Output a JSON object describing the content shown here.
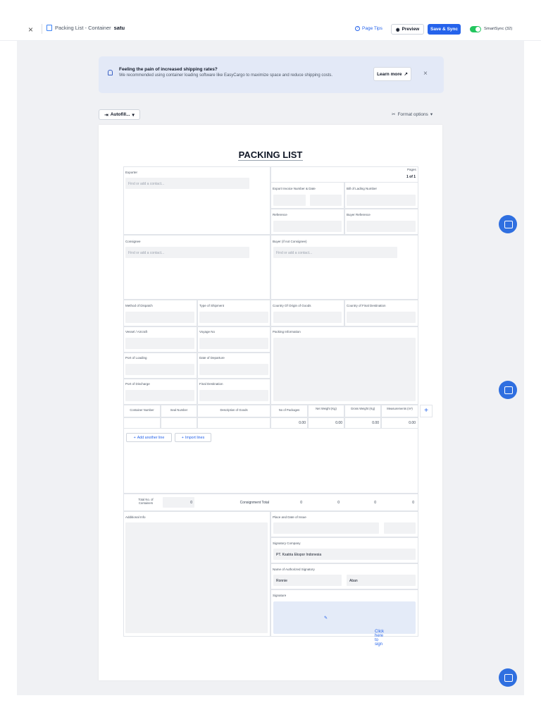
{
  "topbar": {
    "close": "×",
    "title_prefix": "Packing List - Container",
    "title_name": "satu",
    "page_tips": "Page Tips",
    "preview": "Preview",
    "save_sync": "Save & Sync",
    "smartsync": "SmartSync (32)",
    "smartsync_on": true
  },
  "banner": {
    "title": "Feeling the pain of increased shipping rates?",
    "text": "We recommended using container loading software like EasyCargo to maximize space and reduce shipping costs.",
    "learn_more": "Learn more",
    "close": "×"
  },
  "toolbar": {
    "autofill": "Autofill...",
    "format_options": "Format options"
  },
  "document": {
    "title": "PACKING LIST",
    "pages_label": "Pages",
    "pages_value": "1 of 1",
    "exporter": {
      "label": "Exporter",
      "placeholder": "Find or add a contact..."
    },
    "export_invoice": "Export Invoice Number & Date",
    "bill_of_lading": "Bill of Lading Number",
    "reference": "Reference",
    "buyer_reference": "Buyer Reference",
    "consignee": {
      "label": "Consignee",
      "placeholder": "Find or add a contact..."
    },
    "buyer_if_not_consignee": {
      "label": "Buyer (if not Consignee)",
      "placeholder": "Find or add a contact..."
    },
    "method_of_dispatch": "Method of Dispatch",
    "type_of_shipment": "Type of Shipment",
    "country_of_origin": "Country Of Origin of Goods",
    "country_final_destination": "Country of Final Destination",
    "vessel_aircraft": "Vessel / Aircraft",
    "voyage_no": "Voyage No",
    "packing_information": "Packing Information",
    "port_of_loading": "Port of Loading",
    "date_of_departure": "Date of Departure",
    "port_of_discharge": "Port of Discharge",
    "final_destination": "Final Destination",
    "table": {
      "columns": [
        "Container Number",
        "Seal Number",
        "Description of Goods",
        "No of Packages",
        "Net Weight (Kg)",
        "Gross Weight (Kg)",
        "Measurements (m³)"
      ],
      "row": [
        "",
        "",
        "",
        "0.00",
        "0.00",
        "0.00",
        "0.00"
      ],
      "add_column": "+",
      "add_line": "Add another line",
      "import_lines": "Import lines"
    },
    "totals": {
      "total_containers_label": "Total No. of Containers",
      "total_containers_value": "0",
      "consignment_total_label": "Consignment Total",
      "values": [
        "0",
        "0",
        "0",
        "0"
      ]
    },
    "additional_info": "Additional Info",
    "place_date_issue": "Place and Date of Issue",
    "signatory_company": {
      "label": "Signatory Company",
      "value": "PT. Ksatria Ekspor Indonesia"
    },
    "authorized_signatory": {
      "label": "Name of Authorized Signatory",
      "first": "Ronnie",
      "last": "Aban"
    },
    "signature": {
      "label": "Signature",
      "action": "Click here to sign"
    }
  }
}
